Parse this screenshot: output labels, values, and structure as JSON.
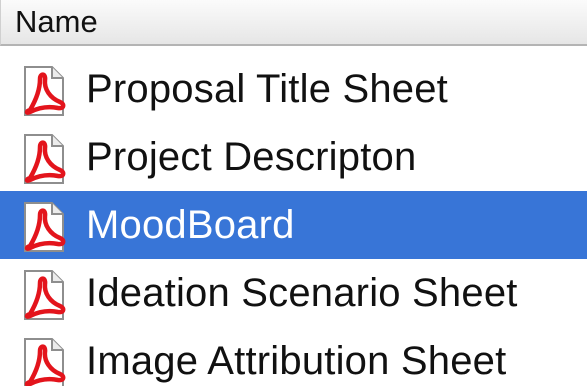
{
  "header": {
    "column_name": "Name"
  },
  "files": [
    {
      "label": "Proposal Title Sheet",
      "icon": "pdf-icon",
      "selected": false
    },
    {
      "label": "Project Descripton",
      "icon": "pdf-icon",
      "selected": false
    },
    {
      "label": "MoodBoard",
      "icon": "pdf-icon",
      "selected": true
    },
    {
      "label": "Ideation Scenario Sheet",
      "icon": "pdf-icon",
      "selected": false
    },
    {
      "label": "Image Attribution Sheet",
      "icon": "pdf-icon",
      "selected": false
    }
  ],
  "colors": {
    "selection": "#3875d7",
    "pdf_red": "#e3141c"
  }
}
